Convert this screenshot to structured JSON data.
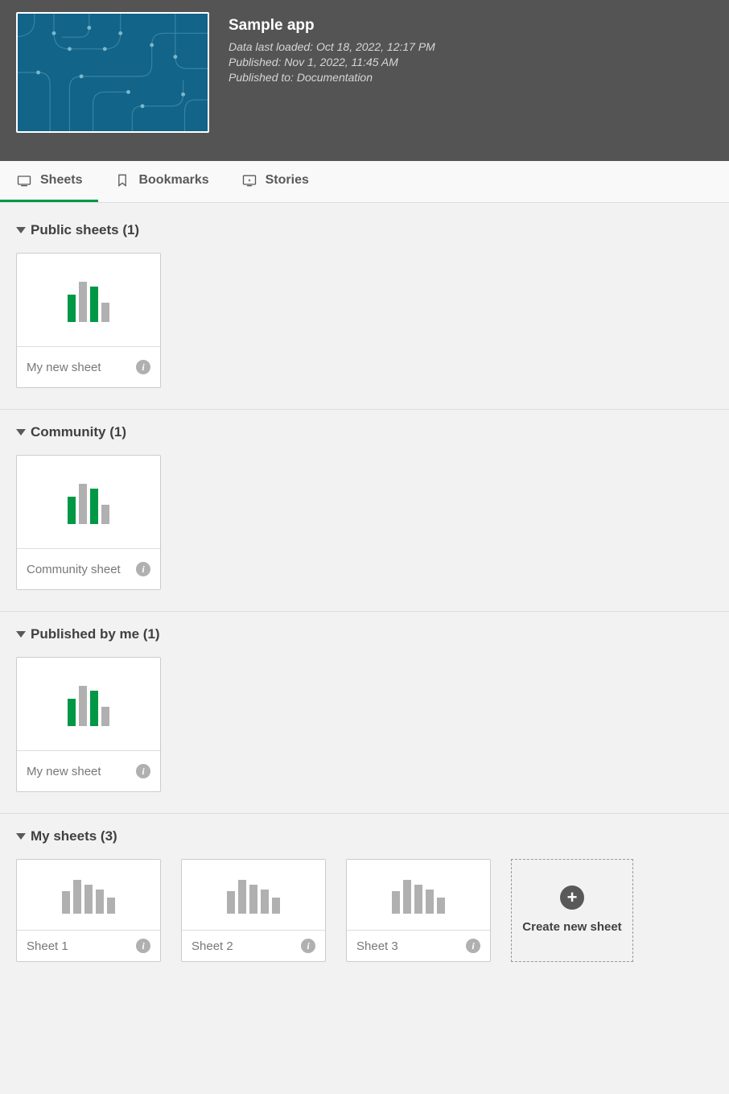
{
  "header": {
    "title": "Sample app",
    "data_loaded": "Data last loaded: Oct 18, 2022, 12:17 PM",
    "published": "Published: Nov 1, 2022, 11:45 AM",
    "published_to": "Published to: Documentation"
  },
  "tabs": {
    "sheets": "Sheets",
    "bookmarks": "Bookmarks",
    "stories": "Stories"
  },
  "sections": {
    "public": {
      "label": "Public sheets (1)",
      "items": [
        {
          "title": "My new sheet"
        }
      ]
    },
    "community": {
      "label": "Community (1)",
      "items": [
        {
          "title": "Community sheet"
        }
      ]
    },
    "published_by_me": {
      "label": "Published by me (1)",
      "items": [
        {
          "title": "My new sheet"
        }
      ]
    },
    "my_sheets": {
      "label": "My sheets (3)",
      "items": [
        {
          "title": "Sheet 1"
        },
        {
          "title": "Sheet 2"
        },
        {
          "title": "Sheet 3"
        }
      ],
      "create_label": "Create new sheet"
    }
  }
}
